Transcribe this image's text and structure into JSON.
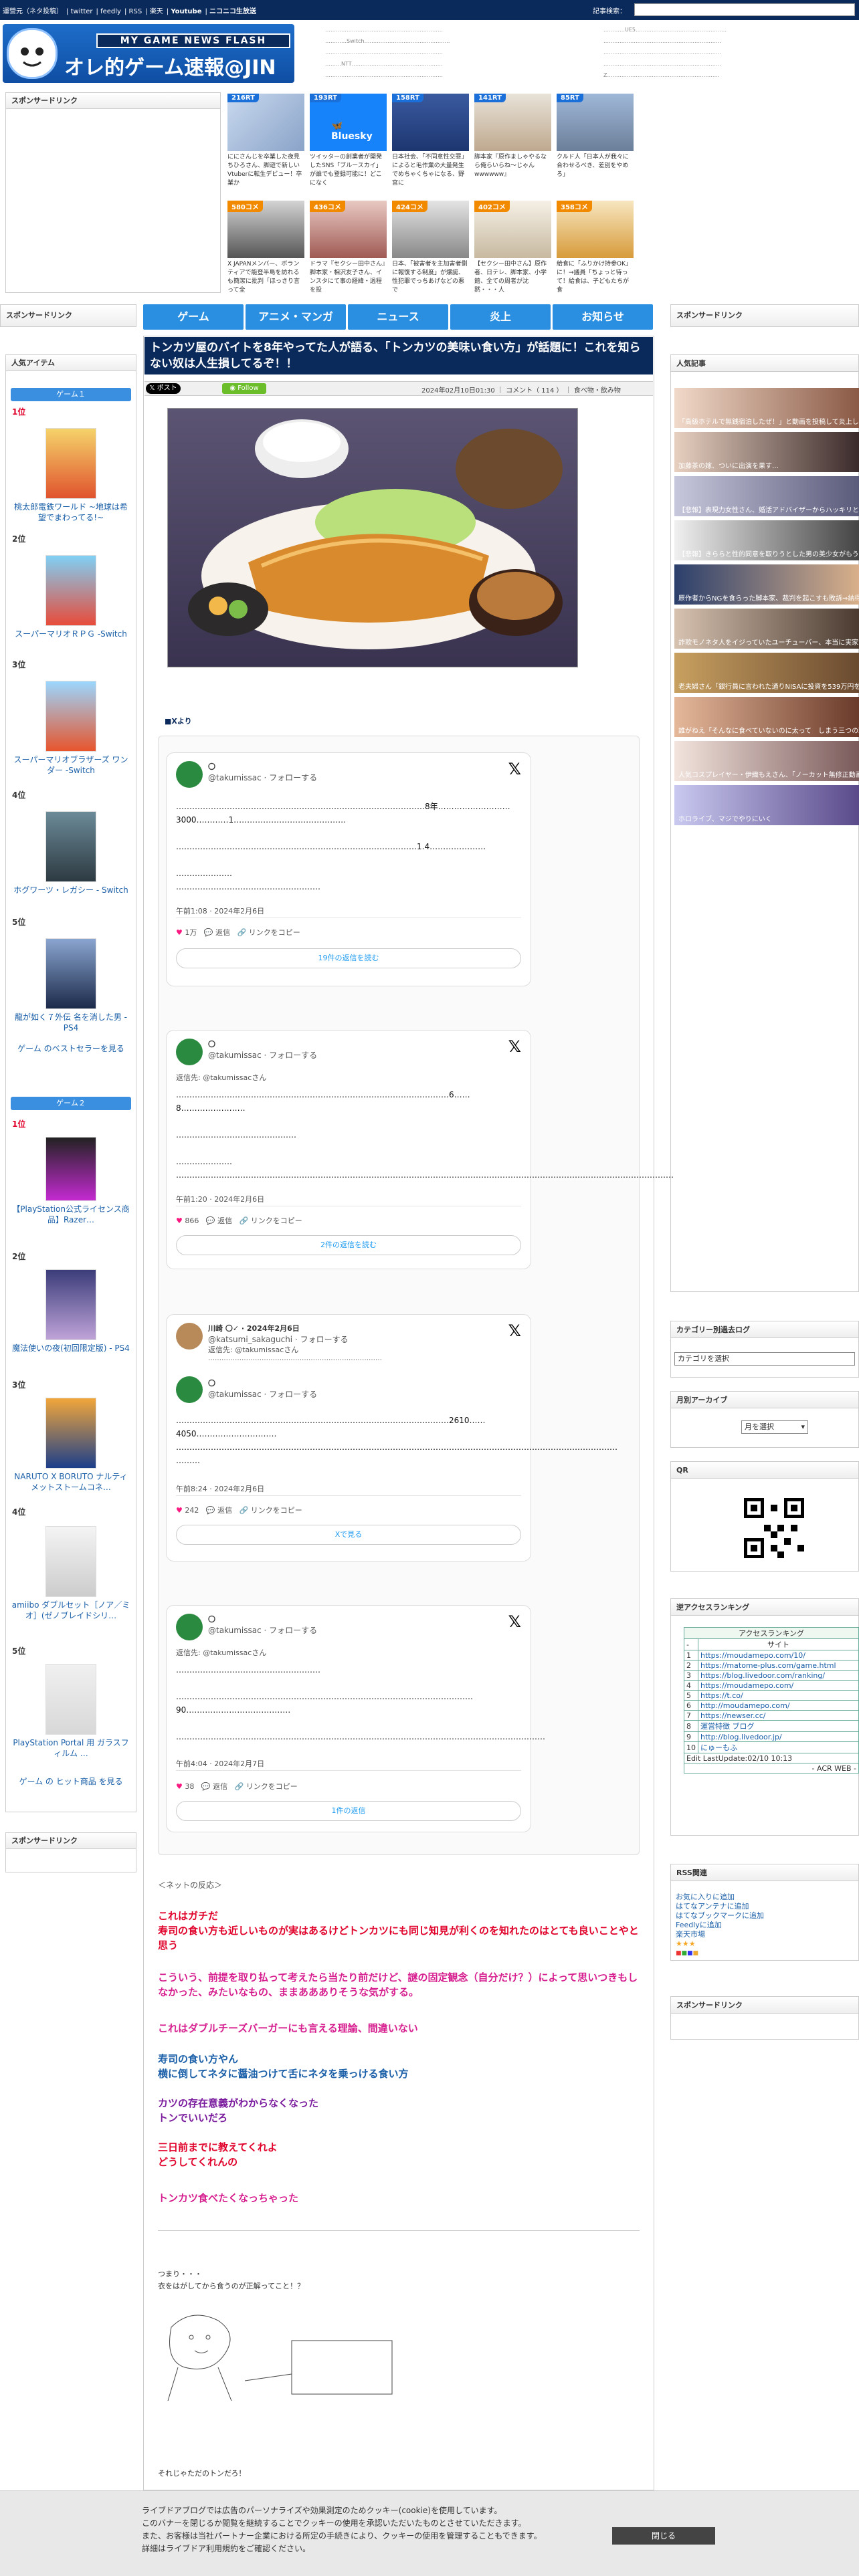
{
  "topbar": {
    "links": [
      "運營元（ネタ投稿）",
      "twitter",
      "feedly",
      "RSS",
      "楽天",
      "Youtube",
      "ニコニコ生放送"
    ],
    "search_label": "記事検索："
  },
  "logo": {
    "subtitle": "MY GAME NEWS FLASH",
    "title": "オレ的ゲーム速報@JIN"
  },
  "header_links_a": [
    "…………………………………………………………",
    "…………Switch…………………………………………",
    "…………………………………………………………",
    "………NTT……………………………………………",
    "…………………………………………………………"
  ],
  "header_links_b": [
    "…………UE5……………………………………………",
    "…………………………………………………………",
    "…………………………………………………………",
    "…………………………………………………………",
    "Z………………………………………………………"
  ],
  "sponsor_link": "スポンサードリンク",
  "ads_top": [
    {
      "badge": "216RT",
      "text": "ににさんじを卒業した夜見ちひろさん、脚遊で新しいVtuberに転生デビュー！卒業か"
    },
    {
      "badge": "193RT",
      "text": "ツイッターの創業者が開発したSNS「ブルースカイ」が誰でも登録可能に！どこになく"
    },
    {
      "badge": "158RT",
      "text": "日本社会、「不同意性交罪」によると毛作業の大量発生でめちゃくちゃになる、野宮に"
    },
    {
      "badge": "141RT",
      "text": "脚本家『原作ましゃやるなら俺らいらね〜じゃんwwwwww』"
    },
    {
      "badge": "85RT",
      "text": "クルド人「日本人が我々に合わせるべき、差別をやめろ」"
    }
  ],
  "ads_bottom": [
    {
      "badge": "580コメ",
      "text": "X JAPANメンバー、ボランティアで能登半島を訪れるも簡潔に批判「ほっきり言って全"
    },
    {
      "badge": "436コメ",
      "text": "ドラマ『セクシー田中さん』脚本家・相沢友子さん、インスタにて事の経緯・過程を投"
    },
    {
      "badge": "424コメ",
      "text": "日本、「被害者を主加害者側に報復する制度」が爆誕、性犯罪でっちあげなどの悪で"
    },
    {
      "badge": "402コメ",
      "text": "【セクシー田中さん】原作者、日テレ、脚本家、小学館、全ての周者が沈黙・・・人"
    },
    {
      "badge": "358コメ",
      "text": "給食に「ふりかけ持参OK」に！→議員「ちょっと待って！給食は、子どもたちが食"
    }
  ],
  "nav": [
    "ゲーム",
    "アニメ・マンガ",
    "ニュース",
    "炎上",
    "お知らせ"
  ],
  "left": {
    "popular_title": "人気アイテム",
    "game1": "ゲーム１",
    "game2": "ゲーム２",
    "ranks1": [
      {
        "no": "1位",
        "label": "桃太郎電鉄ワールド ~地球は希望でまわってる!~"
      },
      {
        "no": "2位",
        "label": "スーパーマリオＲＰＧ -Switch"
      },
      {
        "no": "3位",
        "label": "スーパーマリオブラザーズ ワンダー -Switch"
      },
      {
        "no": "4位",
        "label": "ホグワーツ・レガシー - Switch"
      },
      {
        "no": "5位",
        "label": "龍が如く７外伝 名を消した男 - PS4"
      }
    ],
    "best1": "ゲーム のベストセラーを見る",
    "ranks2": [
      {
        "no": "1位",
        "label": "【PlayStation公式ライセンス商品】Razer…"
      },
      {
        "no": "2位",
        "label": "魔法使いの夜(初回限定版) - PS4"
      },
      {
        "no": "3位",
        "label": "NARUTO X BORUTO ナルティメットストームコネ…"
      },
      {
        "no": "4位",
        "label": "amiibo ダブルセット［ノア／ミオ］(ゼノブレイドシリ…"
      },
      {
        "no": "5位",
        "label": "PlayStation Portal 用 ガラスフィルム …"
      }
    ],
    "best2": "ゲーム の ヒット商品 を見る",
    "sponsor_bottom": "スポンサードリンク"
  },
  "article": {
    "title": "トンカツ屋のバイトを8年やってた人が語る、「トンカツの美味い食い方」が話題に！これを知らない奴は人生損してるぞ！！",
    "post_btn": "ポスト",
    "follow_btn": "Follow",
    "meta": "2024年02月10日01:30 ｜ コメント（ 114 ） ｜ 食べ物・飲み物",
    "source": "■Xより",
    "comment_head": "＜ネットの反応＞",
    "comments": [
      {
        "text": "これはガチだ\n寿司の食い方も近しいものが実はあるけどトンカツにも同じ知見が利くのを知れたのはとても良いことやと思う",
        "color": "red"
      },
      {
        "text": "こういう、前提を取り払って考えたら当たり前だけど、謎の固定観念（自分だけ？）によって思いつきもしなかった、みたいなもの、ままああありそうな気がする。",
        "color": "mag"
      },
      {
        "text": "これはダブルチーズバーガーにも言える理論、間違いない",
        "color": "mag"
      },
      {
        "text": "寿司の食い方やん\n横に倒してネタに醤油つけて舌にネタを乗っける食い方",
        "color": "blue"
      },
      {
        "text": "カツの存在意義がわからなくなった\nトンでいいだろ",
        "color": "purple"
      },
      {
        "text": "三日前までに教えてくれよ\nどうしてくれんの",
        "color": "red"
      },
      {
        "text": "トンカツ食べたくなっちゃった",
        "color": "mag"
      }
    ],
    "aa_caption": "つまり・・・\n衣をはがしてから食うのが正解ってこと！？",
    "closing": "それじゃただのトンだろ！"
  },
  "tweets": [
    {
      "name": "〇",
      "handle": "@takumissac · フォローする",
      "body": "…………………………………………………………………………………8年………………………3000…………1……………………………………\n\n………………………………………………………………………………1.4…………………\n\n…………………\n………………………………………………",
      "time": "午前1:08 · 2024年2月6日",
      "likes": "1万",
      "replies": "返信",
      "copy": "リンクをコピー",
      "more": "19件の返信を読む"
    },
    {
      "name": "〇",
      "handle": "@takumissac · フォローする",
      "reply_to": "返信先: @takumissacさん",
      "body": "…………………………………………………………………………………………6……8……………………\n\n………………………………………\n\n…………………\n……………………………………………………………………………………………………………………………………………………………………",
      "time": "午前1:20 · 2024年2月6日",
      "likes": "866",
      "replies": "返信",
      "copy": "リンクをコピー",
      "more": "2件の返信を読む"
    },
    {
      "quote_name": "川崎 〇✓ · 2024年2月6日",
      "quote_handle": "@katsumi_sakaguchi · フォローする",
      "quote_reply": "返信先: @takumissacさん",
      "quote_body": "……………………………………………………………………",
      "name": "〇",
      "handle": "@takumissac · フォローする",
      "body": "…………………………………………………………………………………………2610……4050…………………………\n…………………………………………………………………………………………………………………………………………………\n………",
      "time": "午前8:24 · 2024年2月6日",
      "likes": "242",
      "replies": "返信",
      "copy": "リンクをコピー",
      "more": "Xで見る"
    },
    {
      "name": "〇",
      "handle": "@takumissac · フォローする",
      "reply_to": "返信先: @takumissacさん",
      "body": "………………………………………………\n\n…………………………………………………………………………………………………90…………………………………\n\n…………………………………………………………………………………………………………………………",
      "time": "午前4:04 · 2024年2月7日",
      "likes": "38",
      "replies": "返信",
      "copy": "リンクをコピー",
      "more": "1件の返信"
    }
  ],
  "right": {
    "sponsor": "スポンサードリンク",
    "popular": "人気記事",
    "pop_items": [
      "「高級ホテルで無銭宿泊したぜ！」と動画を投稿して炎上していたユーチューバー、ホテルに連",
      "加藤茶の嫁、ついに出演を果す…",
      "【悲報】表現力女性さん、婚活アドバイザーからハッキリと地雷認定されてしまうwwwwwwww",
      "【悲報】きららと性的同意を取りうとした男の美少女がもう",
      "原作者からNGを食らった脚本家、裁判を起こすも敗訴⇒納得できなさ・・・",
      "詐欺モノネタ人をイジっていたユーチューバー、本当に実家がヤバすぎる件が届けられ・・・",
      "老夫婦さん「銀行員に言われた通りNISAに投資を539万円を投資した。今後も安心だな！」→その結果",
      "誰がねえ「そんなに食べていないのに太って　しまう三つの理由」その１が大正ストレートすぎる",
      "人気コスプレイヤー・伊織もえさん、「ノーカット無修正動画」を公開！",
      "ホロライブ、マジでやりにいく"
    ],
    "category_title": "カテゴリー別過去ログ",
    "category_select": "カテゴリを選択",
    "monthly_title": "月別アーカイブ",
    "monthly_select": "月を選択",
    "qr_title": "QR",
    "access_title": "逆アクセスランキング",
    "access_head1": "アクセスランキング",
    "access_head2": "サイト",
    "access_rows": [
      "https://moudamepo.com/10/",
      "https://matome-plus.com/game.html",
      "https://blog.livedoor.com/ranking/",
      "https://moudamepo.com/",
      "https://t.co/",
      "http://moudamepo.com/",
      "https://newser.cc/",
      "運営特徴 ブログ",
      "http://blog.livedoor.jp/",
      "にゅーもふ"
    ],
    "access_foot": "Edit LastUpdate:02/10 10:13",
    "access_acr": "- ACR WEB -",
    "rss_title": "RSS関連",
    "rss_links": [
      "お気に入りに追加",
      "はてなアンテナに追加",
      "はてなブックマークに追加",
      "Feedlyに追加",
      "楽天市場"
    ],
    "sponsor2": "スポンサードリンク"
  },
  "cookie": {
    "line1": "ライブドアブログでは広告のパーソナライズや効果測定のためクッキー(cookie)を使用しています。",
    "line2": "このバナーを閉じるか閲覧を継続することでクッキーの使用を承認いただいたものとさせていただきます。",
    "line3": "また、お客様は当社パートナー企業における所定の手続きにより、クッキーの使用を管理することもできます。",
    "line4": "詳細はライブドア利用規約をご確認ください。",
    "close": "閉じる"
  }
}
